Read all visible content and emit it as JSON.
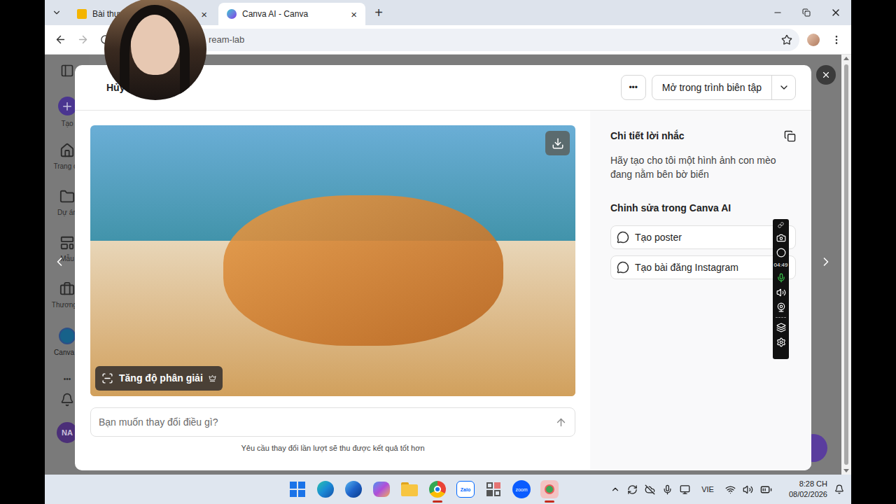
{
  "browser": {
    "tabs": [
      {
        "label": "Bài thuyết",
        "selected": false,
        "close": "×"
      },
      {
        "label": "Canva AI - Canva",
        "selected": true,
        "close": "×"
      }
    ],
    "new_tab": "+",
    "url": "ream-lab"
  },
  "canva_sidebar": {
    "items": [
      {
        "label": "Tạo",
        "kind": "create",
        "selected": false
      },
      {
        "label": "Trang ch",
        "kind": "home",
        "selected": false
      },
      {
        "label": "Dự án",
        "kind": "projects",
        "selected": false
      },
      {
        "label": "Mẫu",
        "kind": "templates",
        "selected": false
      },
      {
        "label": "Thương h",
        "kind": "brand",
        "selected": false
      },
      {
        "label": "Canva A",
        "kind": "canva-ai",
        "selected": true
      }
    ],
    "more": "•••",
    "avatar": "NA"
  },
  "dialog": {
    "cancel": "Hủy",
    "more": "•••",
    "open_editor": "Mở trong trình biên tập",
    "upscale": "Tăng độ phân giải",
    "input": {
      "placeholder": "Bạn muốn thay đổi điều gì?"
    },
    "hint": "Yêu cầu thay đổi lần lượt sẽ thu được kết quả tốt hơn",
    "prompt_title": "Chi tiết lời nhắc",
    "prompt": "Hãy tạo cho tôi một hình ảnh con mèo đang nằm bên bờ biển",
    "edit_title": "Chỉnh sửa trong Canva AI",
    "actions": [
      "Tạo poster",
      "Tạo bài đăng Instagram"
    ]
  },
  "recorder": {
    "timer": "04:49"
  },
  "taskbar": {
    "apps": [
      {
        "kind": "windows",
        "active": false
      },
      {
        "kind": "edge",
        "active": false
      },
      {
        "kind": "edge-dev",
        "active": false
      },
      {
        "kind": "copilot",
        "active": false
      },
      {
        "kind": "explorer",
        "active": false
      },
      {
        "kind": "chrome",
        "active": true
      },
      {
        "kind": "zalo",
        "label": "Zalo",
        "active": false
      },
      {
        "kind": "snip",
        "active": false
      },
      {
        "kind": "zoom",
        "label": "zoom",
        "active": false
      },
      {
        "kind": "capture",
        "active": true
      }
    ],
    "language": "VIE",
    "time": "8:28 CH",
    "date": "08/02/2026"
  }
}
